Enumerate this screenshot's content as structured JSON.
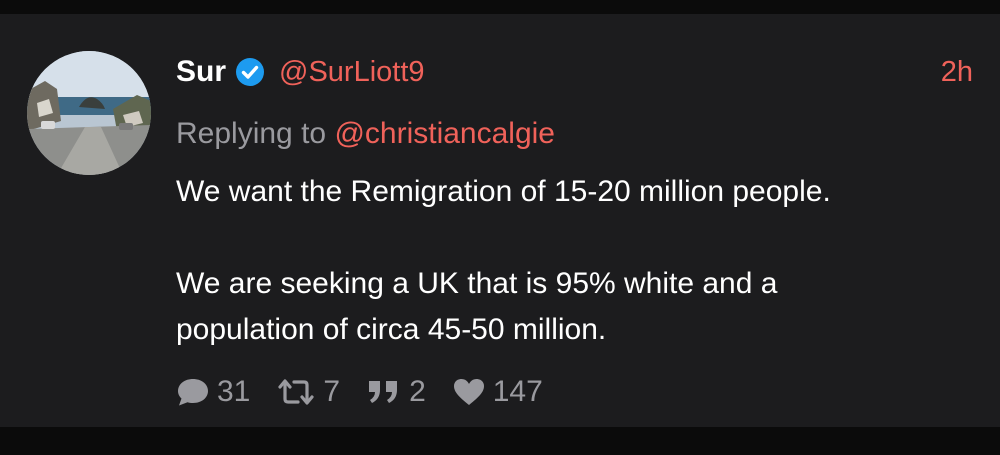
{
  "post": {
    "author": {
      "display_name": "Sur",
      "verified": true,
      "handle": "@SurLiott9",
      "avatar_icon": "avatar-photo-coastal-village"
    },
    "timestamp": "2h",
    "replying_to": {
      "prefix": "Replying to",
      "handle": "@christiancalgie"
    },
    "text": {
      "paragraph_1": "We want the Remigration of 15-20 million people.",
      "paragraph_2_line_1": "We are seeking a UK that is 95% white and a",
      "paragraph_2_line_2": "population of circa 45-50 million."
    },
    "stats": {
      "replies": "31",
      "reposts": "7",
      "quotes": "2",
      "likes": "147"
    }
  },
  "colors": {
    "background": "#1c1c1e",
    "outer_background": "#0b0b0b",
    "accent": "#f0625a",
    "muted": "#9a9a9f",
    "text": "#ffffff",
    "verified_badge": "#1d9bf0"
  }
}
